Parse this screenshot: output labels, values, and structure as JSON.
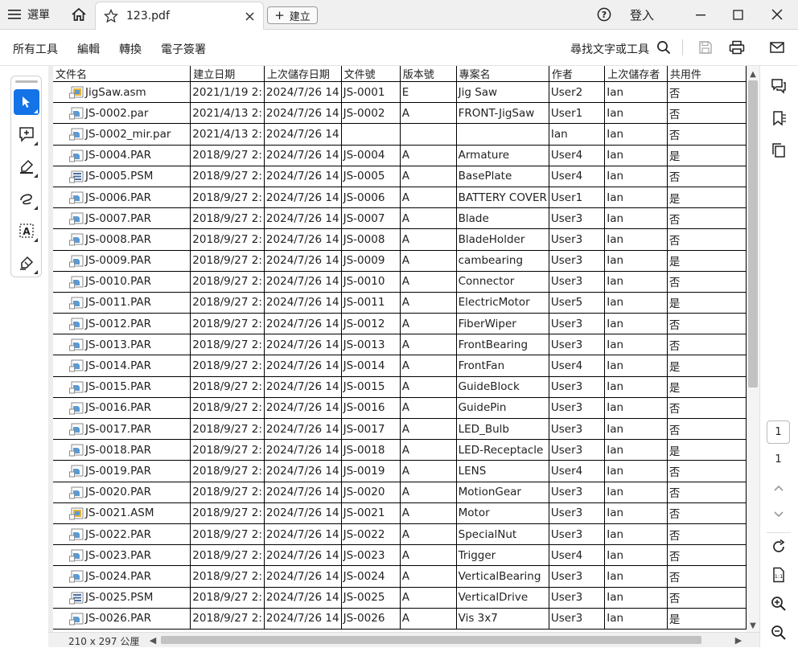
{
  "titlebar": {
    "menu_label": "選單",
    "tab_title": "123.pdf",
    "new_label": "建立",
    "login_label": "登入"
  },
  "toolbar": {
    "items": [
      "所有工具",
      "編輯",
      "轉換",
      "電子簽署"
    ],
    "search_label": "尋找文字或工具"
  },
  "table": {
    "headers": [
      "文件名",
      "建立日期",
      "上次儲存日期",
      "文件號",
      "版本號",
      "專案名",
      "作者",
      "上次儲存者",
      "共用件"
    ],
    "rows": [
      {
        "icon": "asm",
        "cells": [
          "JigSaw.asm",
          "2021/1/19 2:",
          "2024/7/26 14",
          "JS-0001",
          "E",
          "Jig Saw",
          "User2",
          "Ian",
          "否"
        ]
      },
      {
        "icon": "par",
        "cells": [
          "JS-0002.par",
          "2021/4/13 2:",
          "2024/7/26 14",
          "JS-0002",
          "A",
          "FRONT-JigSaw",
          "User1",
          "Ian",
          "否"
        ]
      },
      {
        "icon": "par",
        "cells": [
          "JS-0002_mir.par",
          "2021/4/13 2:",
          "2024/7/26 14",
          "",
          "",
          "",
          "Ian",
          "Ian",
          "否"
        ]
      },
      {
        "icon": "par",
        "cells": [
          "JS-0004.PAR",
          "2018/9/27 2:",
          "2024/7/26 14",
          "JS-0004",
          "A",
          "Armature",
          "User4",
          "Ian",
          "是"
        ]
      },
      {
        "icon": "psm",
        "cells": [
          "JS-0005.PSM",
          "2018/9/27 2:",
          "2024/7/26 14",
          "JS-0005",
          "A",
          "BasePlate",
          "User4",
          "Ian",
          "否"
        ]
      },
      {
        "icon": "par",
        "cells": [
          "JS-0006.PAR",
          "2018/9/27 2:",
          "2024/7/26 14",
          "JS-0006",
          "A",
          "BATTERY COVER",
          "User1",
          "Ian",
          "是"
        ]
      },
      {
        "icon": "par",
        "cells": [
          "JS-0007.PAR",
          "2018/9/27 2:",
          "2024/7/26 14",
          "JS-0007",
          "A",
          "Blade",
          "User3",
          "Ian",
          "否"
        ]
      },
      {
        "icon": "par",
        "cells": [
          "JS-0008.PAR",
          "2018/9/27 2:",
          "2024/7/26 14",
          "JS-0008",
          "A",
          "BladeHolder",
          "User3",
          "Ian",
          "否"
        ]
      },
      {
        "icon": "par",
        "cells": [
          "JS-0009.PAR",
          "2018/9/27 2:",
          "2024/7/26 14",
          "JS-0009",
          "A",
          "cambearing",
          "User3",
          "Ian",
          "是"
        ]
      },
      {
        "icon": "par",
        "cells": [
          "JS-0010.PAR",
          "2018/9/27 2:",
          "2024/7/26 14",
          "JS-0010",
          "A",
          "Connector",
          "User3",
          "Ian",
          "否"
        ]
      },
      {
        "icon": "par",
        "cells": [
          "JS-0011.PAR",
          "2018/9/27 2:",
          "2024/7/26 14",
          "JS-0011",
          "A",
          "ElectricMotor",
          "User5",
          "Ian",
          "是"
        ]
      },
      {
        "icon": "par",
        "cells": [
          "JS-0012.PAR",
          "2018/9/27 2:",
          "2024/7/26 14",
          "JS-0012",
          "A",
          "FiberWiper",
          "User3",
          "Ian",
          "否"
        ]
      },
      {
        "icon": "par",
        "cells": [
          "JS-0013.PAR",
          "2018/9/27 2:",
          "2024/7/26 14",
          "JS-0013",
          "A",
          "FrontBearing",
          "User3",
          "Ian",
          "否"
        ]
      },
      {
        "icon": "par",
        "cells": [
          "JS-0014.PAR",
          "2018/9/27 2:",
          "2024/7/26 14",
          "JS-0014",
          "A",
          "FrontFan",
          "User4",
          "Ian",
          "是"
        ]
      },
      {
        "icon": "par",
        "cells": [
          "JS-0015.PAR",
          "2018/9/27 2:",
          "2024/7/26 14",
          "JS-0015",
          "A",
          "GuideBlock",
          "User3",
          "Ian",
          "是"
        ]
      },
      {
        "icon": "par",
        "cells": [
          "JS-0016.PAR",
          "2018/9/27 2:",
          "2024/7/26 14",
          "JS-0016",
          "A",
          "GuidePin",
          "User3",
          "Ian",
          "否"
        ]
      },
      {
        "icon": "par",
        "cells": [
          "JS-0017.PAR",
          "2018/9/27 2:",
          "2024/7/26 14",
          "JS-0017",
          "A",
          "LED_Bulb",
          "User3",
          "Ian",
          "否"
        ]
      },
      {
        "icon": "par",
        "cells": [
          "JS-0018.PAR",
          "2018/9/27 2:",
          "2024/7/26 14",
          "JS-0018",
          "A",
          "LED-Receptacle",
          "User3",
          "Ian",
          "是"
        ]
      },
      {
        "icon": "par",
        "cells": [
          "JS-0019.PAR",
          "2018/9/27 2:",
          "2024/7/26 14",
          "JS-0019",
          "A",
          "LENS",
          "User4",
          "Ian",
          "否"
        ]
      },
      {
        "icon": "par",
        "cells": [
          "JS-0020.PAR",
          "2018/9/27 2:",
          "2024/7/26 14",
          "JS-0020",
          "A",
          "MotionGear",
          "User3",
          "Ian",
          "否"
        ]
      },
      {
        "icon": "asm",
        "cells": [
          "JS-0021.ASM",
          "2018/9/27 2:",
          "2024/7/26 14",
          "JS-0021",
          "A",
          "Motor",
          "User3",
          "Ian",
          "否"
        ]
      },
      {
        "icon": "par",
        "cells": [
          "JS-0022.PAR",
          "2018/9/27 2:",
          "2024/7/26 14",
          "JS-0022",
          "A",
          "SpecialNut",
          "User3",
          "Ian",
          "否"
        ]
      },
      {
        "icon": "par",
        "cells": [
          "JS-0023.PAR",
          "2018/9/27 2:",
          "2024/7/26 14",
          "JS-0023",
          "A",
          "Trigger",
          "User4",
          "Ian",
          "否"
        ]
      },
      {
        "icon": "par",
        "cells": [
          "JS-0024.PAR",
          "2018/9/27 2:",
          "2024/7/26 14",
          "JS-0024",
          "A",
          "VerticalBearing",
          "User3",
          "Ian",
          "否"
        ]
      },
      {
        "icon": "psm",
        "cells": [
          "JS-0025.PSM",
          "2018/9/27 2:",
          "2024/7/26 14",
          "JS-0025",
          "A",
          "VerticalDrive",
          "User3",
          "Ian",
          "否"
        ]
      },
      {
        "icon": "par",
        "cells": [
          "JS-0026.PAR",
          "2018/9/27 2:",
          "2024/7/26 14",
          "JS-0026",
          "A",
          "Vis 3x7",
          "User3",
          "Ian",
          "是"
        ]
      }
    ]
  },
  "statusbar": {
    "page_size": "210 x 297 公厘"
  },
  "pagenav": {
    "current": "1",
    "total": "1"
  },
  "colors": {
    "accent": "#1473e6",
    "icon_par": "#5b9bd5",
    "icon_asm": "#e8b33c",
    "icon_psm": "#4a6fa5"
  }
}
